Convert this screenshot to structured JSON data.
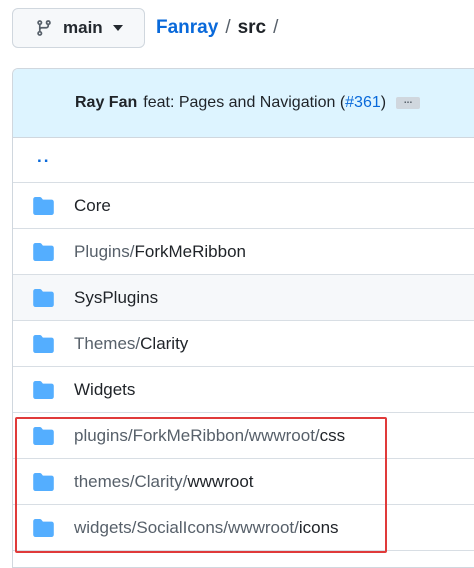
{
  "header": {
    "branch_label": "main",
    "repo_name": "Fanray",
    "sep1": "/",
    "current_dir": "src",
    "sep2": "/"
  },
  "commit": {
    "author": "Ray Fan",
    "message": "feat: Pages and Navigation (",
    "pr_link": "#361",
    "message_end": ")",
    "ellipsis": "..."
  },
  "parent_dir": "..",
  "rows": [
    {
      "prefix": "",
      "name": "Core"
    },
    {
      "prefix": "Plugins/",
      "name": "ForkMeRibbon"
    },
    {
      "prefix": "",
      "name": "SysPlugins"
    },
    {
      "prefix": "Themes/",
      "name": "Clarity"
    },
    {
      "prefix": "",
      "name": "Widgets"
    },
    {
      "prefix": "plugins/ForkMeRibbon/wwwroot/",
      "name": "css"
    },
    {
      "prefix": "themes/Clarity/",
      "name": "wwwroot"
    },
    {
      "prefix": "widgets/SocialIcons/wwwroot/",
      "name": "icons"
    }
  ],
  "colors": {
    "folder": "#54aeff",
    "link": "#0969da",
    "highlight_border": "#e03a3a"
  },
  "icons": {
    "branch": "git-branch-icon",
    "folder": "folder-icon"
  }
}
